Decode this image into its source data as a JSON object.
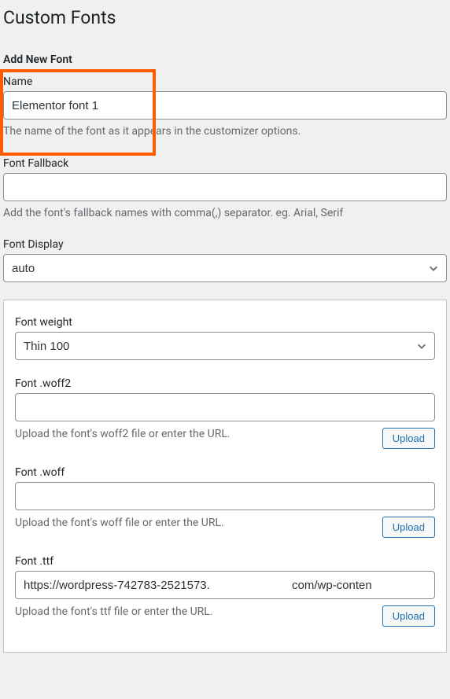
{
  "page": {
    "title": "Custom Fonts",
    "section_title": "Add New Font"
  },
  "fields": {
    "name": {
      "label": "Name",
      "value": "Elementor font 1",
      "help": "The name of the font as it appears in the customizer options."
    },
    "fallback": {
      "label": "Font Fallback",
      "value": "",
      "help": "Add the font's fallback names with comma(,) separator. eg. Arial, Serif"
    },
    "display": {
      "label": "Font Display",
      "value": "auto"
    }
  },
  "variant": {
    "weight": {
      "label": "Font weight",
      "value": "Thin 100"
    },
    "woff2": {
      "label": "Font .woff2",
      "value": "",
      "help": "Upload the font's woff2 file or enter the URL.",
      "button": "Upload"
    },
    "woff": {
      "label": "Font .woff",
      "value": "",
      "help": "Upload the font's woff file or enter the URL.",
      "button": "Upload"
    },
    "ttf": {
      "label": "Font .ttf",
      "value": "https://wordpress-742783-2521573.                         com/wp-conten",
      "help": "Upload the font's ttf file or enter the URL.",
      "button": "Upload"
    }
  }
}
